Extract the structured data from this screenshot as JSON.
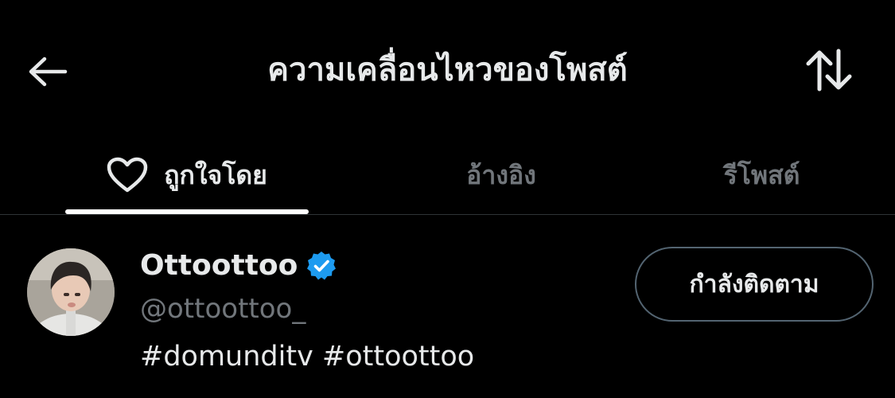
{
  "header": {
    "title": "ความเคลื่อนไหวของโพสต์",
    "back_icon": "arrow-left-icon",
    "sort_icon": "sort-arrows-icon"
  },
  "tabs": [
    {
      "label": "ถูกใจโดย",
      "icon": "heart-icon",
      "active": true
    },
    {
      "label": "อ้างอิง",
      "active": false
    },
    {
      "label": "รีโพสต์",
      "active": false
    }
  ],
  "users": [
    {
      "display_name": "Ottoottoo",
      "verified": true,
      "handle": "@ottoottoo_",
      "bio": "#domunditv #ottoottoo",
      "follow_label": "กำลังติดตาม"
    }
  ],
  "colors": {
    "background": "#000000",
    "text_primary": "#e7e9ea",
    "text_secondary": "#71767b",
    "verified_blue": "#1d9bf0",
    "border": "#2f3336"
  }
}
